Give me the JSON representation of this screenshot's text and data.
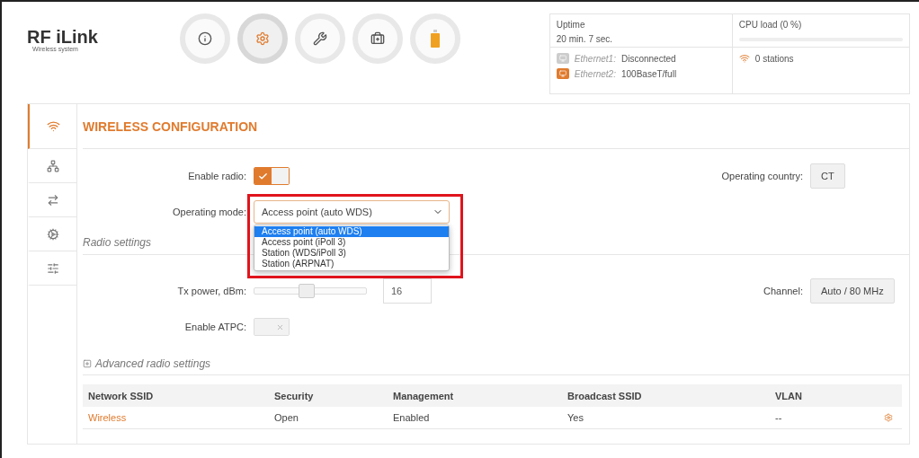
{
  "logo": {
    "name": "RF iLink",
    "tagline": "Wireless system"
  },
  "nav": [
    {
      "selected": false
    },
    {
      "selected": true
    },
    {
      "selected": false
    },
    {
      "selected": false
    },
    {
      "selected": false
    }
  ],
  "status": {
    "uptime_label": "Uptime",
    "uptime": "20 min. 7 sec.",
    "cpu": {
      "label": "CPU load (0 %)"
    },
    "ports": [
      {
        "name": "Ethernet1:",
        "value": "Disconnected",
        "connected": false
      },
      {
        "name": "Ethernet2:",
        "value": "100BaseT/full",
        "connected": true
      }
    ],
    "stations": "0 stations"
  },
  "sidebar": [
    {
      "selected": true
    },
    {
      "selected": false
    },
    {
      "selected": false
    },
    {
      "selected": false
    },
    {
      "selected": false
    }
  ],
  "section_title": "WIRELESS CONFIGURATION",
  "enable_radio": {
    "label": "Enable radio:",
    "on": true
  },
  "operating_country": {
    "label": "Operating country:",
    "value": "CT"
  },
  "operating_mode": {
    "label": "Operating mode:",
    "value": "Access point (auto WDS)",
    "open": true,
    "options": [
      {
        "label": "Access point (auto WDS)",
        "selected": true
      },
      {
        "label": "Access point (iPoll 3)",
        "selected": false
      },
      {
        "label": "Station (WDS/iPoll 3)",
        "selected": false
      },
      {
        "label": "Station (ARPNAT)",
        "selected": false
      }
    ]
  },
  "radio_settings_title": "Radio settings",
  "tx_power": {
    "label": "Tx power, dBm:",
    "level": 0.47,
    "value": "16"
  },
  "channel": {
    "label": "Channel:",
    "value": "Auto / 80 MHz"
  },
  "enable_atpc": {
    "label": "Enable ATPC:",
    "on": false
  },
  "advanced_link": "Advanced radio settings",
  "table": {
    "columns": [
      "Network SSID",
      "Security",
      "Management",
      "Broadcast SSID",
      "VLAN"
    ],
    "rows": [
      {
        "cells": [
          "Wireless",
          "Open",
          "Enabled",
          "Yes",
          "--"
        ]
      }
    ]
  }
}
